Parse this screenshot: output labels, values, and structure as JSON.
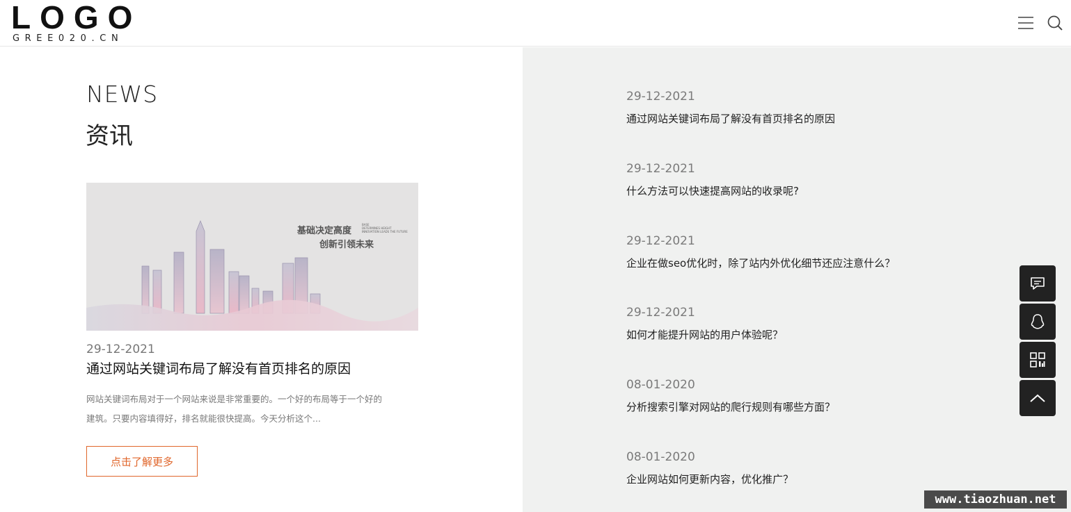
{
  "header": {
    "logo_text": "LOGO",
    "logo_subtext": "GREE020.CN",
    "menu_icon": "menu-icon",
    "search_icon": "search-icon"
  },
  "section": {
    "title_en": "NEWS",
    "title_cn": "资讯"
  },
  "featured": {
    "image_caption_line1": "基础决定高度",
    "image_caption_line2": "创新引领未来",
    "image_small_text_1": "BASE",
    "image_small_text_2": "DETERMINES HEIGHT",
    "image_small_text_3": "INNOVATION LEADS THE FUTURE",
    "date": "29-12-2021",
    "title": "通过网站关键词布局了解没有首页排名的原因",
    "desc_line1": "网站关键词布局对于一个网站来说是非常重要的。一个好的布局等于一个好的",
    "desc_line2": "建筑。只要内容填得好，排名就能很快提高。今天分析这个...",
    "button_label": "点击了解更多"
  },
  "news_list": [
    {
      "date": "29-12-2021",
      "title": "通过网站关键词布局了解没有首页排名的原因"
    },
    {
      "date": "29-12-2021",
      "title": "什么方法可以快速提高网站的收录呢?"
    },
    {
      "date": "29-12-2021",
      "title": "企业在做seo优化时，除了站内外优化细节还应注意什么？"
    },
    {
      "date": "29-12-2021",
      "title": "如何才能提升网站的用户体验呢？"
    },
    {
      "date": "08-01-2020",
      "title": "分析搜索引擎对网站的爬行规则有哪些方面？"
    },
    {
      "date": "08-01-2020",
      "title": "企业网站如何更新内容，优化推广？"
    }
  ],
  "sidebar": {
    "buttons": [
      "message-icon",
      "qq-icon",
      "qr-code-icon",
      "back-to-top-icon"
    ]
  },
  "watermark": "www.tiaozhuan.net",
  "colors": {
    "accent": "#e0662b",
    "panel_bg": "#f0f1f0",
    "side_btn_bg": "#222222"
  }
}
